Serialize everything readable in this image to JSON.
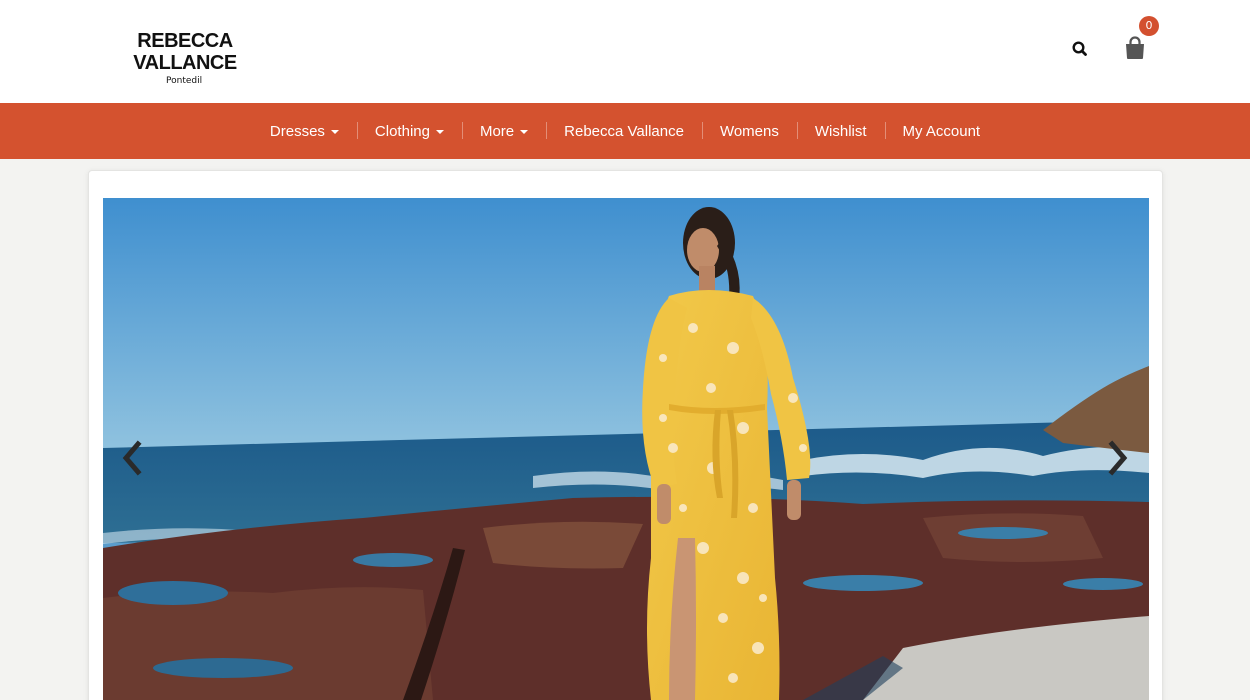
{
  "brand": {
    "name": "REBECCA VALLANCE",
    "subtitle": "Pontedil"
  },
  "header": {
    "search_icon": "search-icon",
    "cart_icon": "shopping-bag-icon",
    "cart_count": "0",
    "accent_color": "#d4522f"
  },
  "nav": {
    "items": [
      {
        "label": "Dresses",
        "has_dropdown": true
      },
      {
        "label": "Clothing",
        "has_dropdown": true
      },
      {
        "label": "More",
        "has_dropdown": true
      },
      {
        "label": "Rebecca Vallance",
        "has_dropdown": false
      },
      {
        "label": "Womens",
        "has_dropdown": false
      },
      {
        "label": "Wishlist",
        "has_dropdown": false
      },
      {
        "label": "My Account",
        "has_dropdown": false
      }
    ]
  },
  "slider": {
    "prev_icon": "chevron-left-icon",
    "next_icon": "chevron-right-icon",
    "image_subject": "model in yellow floral maxi dress on rocky seashore"
  }
}
